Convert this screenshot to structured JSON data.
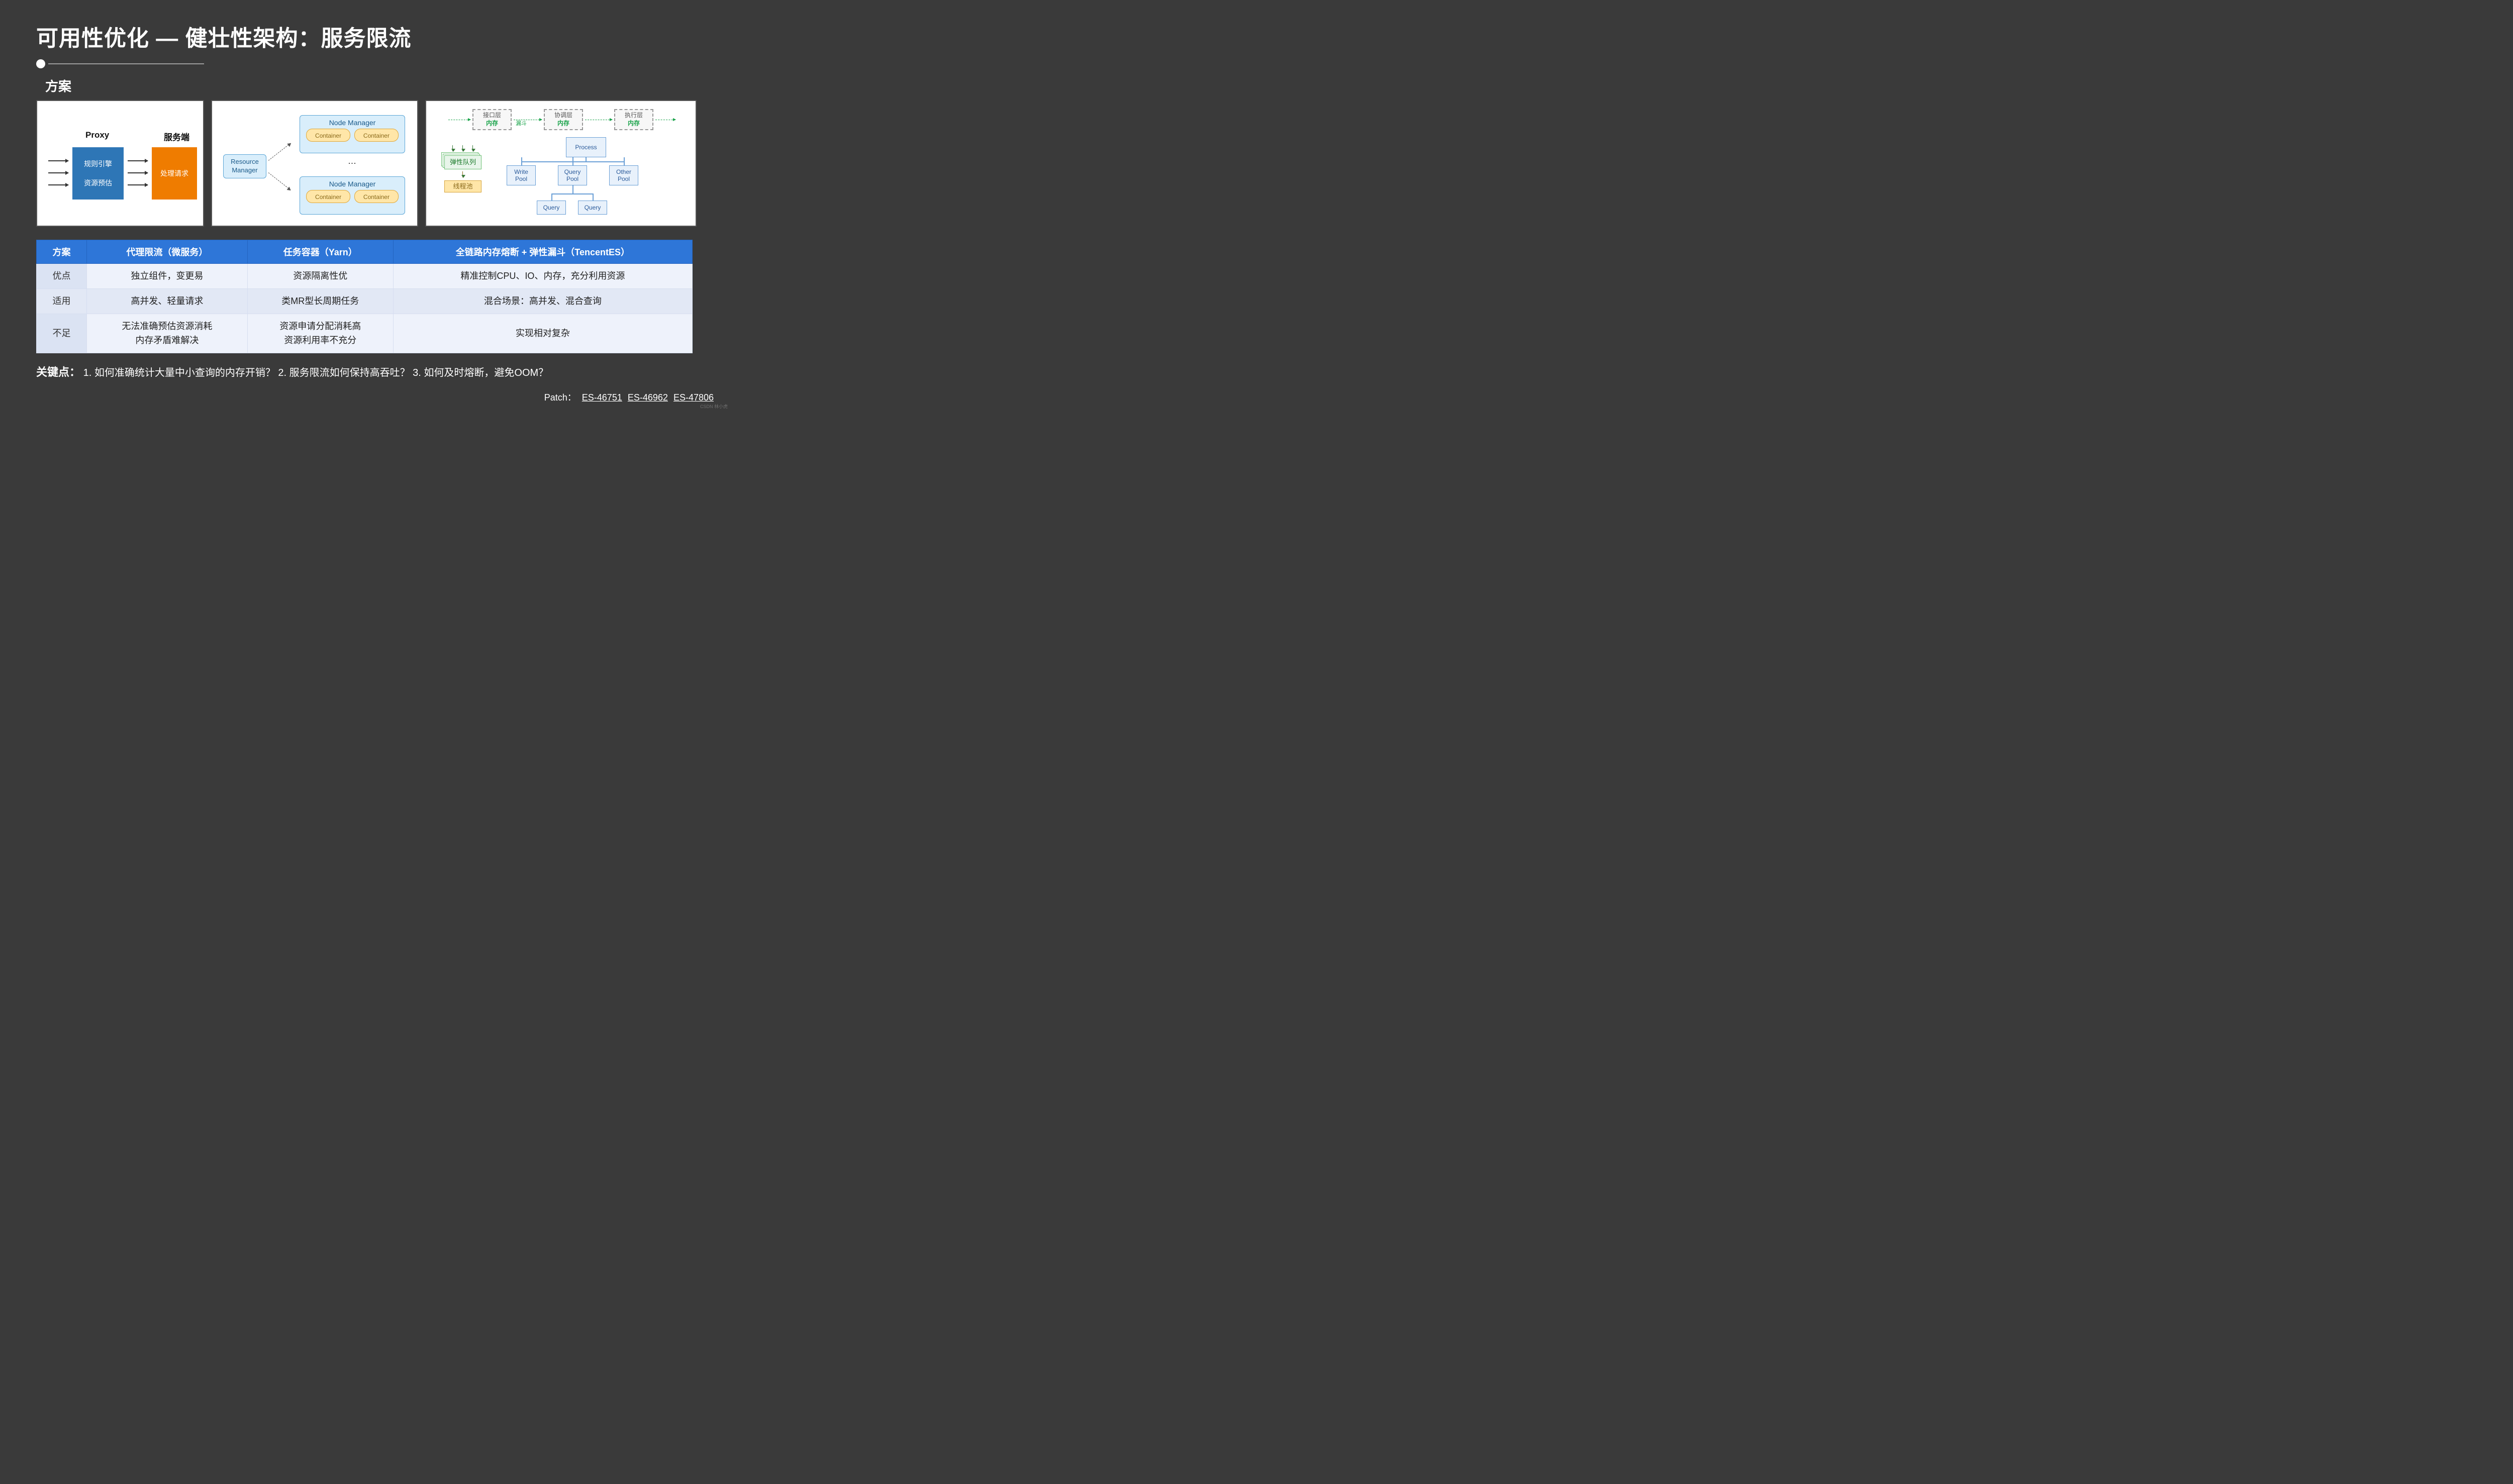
{
  "title": "可用性优化 — 健壮性架构：服务限流",
  "subtitle": "方案",
  "panel1": {
    "proxy_label": "Proxy",
    "server_label": "服务端",
    "rule_engine": "规则引擎",
    "resource_est": "资源预估",
    "handle_req": "处理请求"
  },
  "panel2": {
    "rm": "Resource\nManager",
    "nm": "Node Manager",
    "container": "Container"
  },
  "panel3": {
    "layer1_top": "接口层",
    "layer2_top": "协调层",
    "layer3_top": "执行层",
    "mem": "内存",
    "funnel": "漏斗",
    "elastic_queue": "弹性队列",
    "thread_pool": "线程池",
    "process": "Process",
    "write_pool": "Write\nPool",
    "query_pool": "Query\nPool",
    "other_pool": "Other\nPool",
    "query": "Query"
  },
  "table": {
    "header": [
      "方案",
      "代理限流（微服务）",
      "任务容器（Yarn）",
      "全链路内存熔断 + 弹性漏斗（TencentES）"
    ],
    "rows": [
      {
        "label": "优点",
        "cells": [
          "独立组件，变更易",
          "资源隔离性优",
          "精准控制CPU、IO、内存，充分利用资源"
        ]
      },
      {
        "label": "适用",
        "cells": [
          "高并发、轻量请求",
          "类MR型长周期任务",
          "混合场景：高并发、混合查询"
        ]
      },
      {
        "label": "不足",
        "cells": [
          "无法准确预估资源消耗\n内存矛盾难解决",
          "资源申请分配消耗高\n资源利用率不充分",
          "实现相对复杂"
        ]
      }
    ]
  },
  "keypoints": {
    "label": "关键点：",
    "text": "1. 如何准确统计大量中小查询的内存开销？ 2. 服务限流如何保持高吞吐？ 3. 如何及时熔断，避免OOM？"
  },
  "patch": {
    "label": "Patch：",
    "links": [
      "ES-46751",
      "ES-46962",
      "ES-47806"
    ]
  },
  "watermark": "CSDN 林小虎"
}
